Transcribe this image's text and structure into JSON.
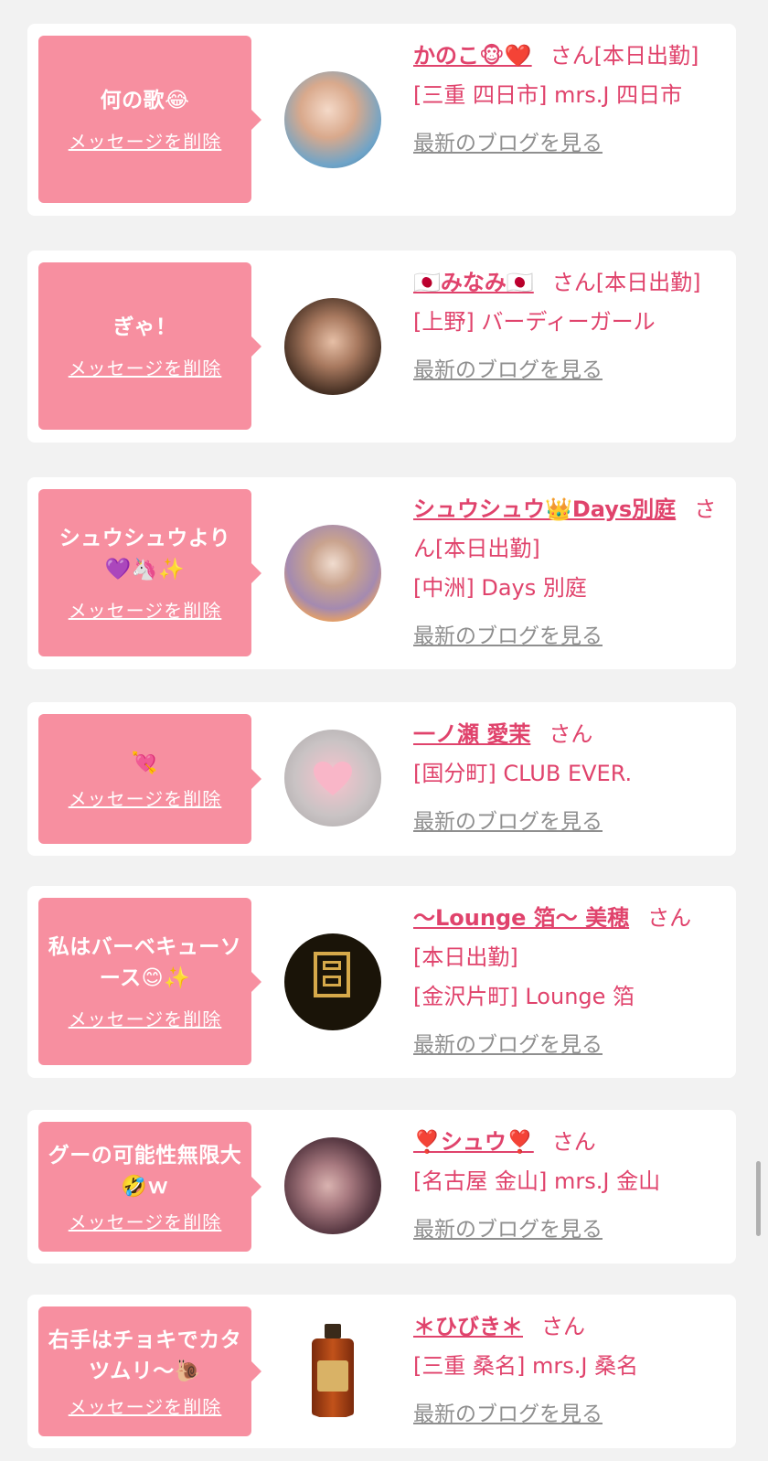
{
  "delete_label": "メッセージを削除",
  "blog_label": "最新のブログを見る",
  "san_label": "さん",
  "colors": {
    "accent": "#e0436c",
    "bubble": "#f78fa0",
    "link_gray": "#8f8f8f",
    "background": "#f2f2f2"
  },
  "items": [
    {
      "message": "何の歌😂",
      "name": "かのこ🐵❤️",
      "status": "[本日出勤]",
      "shop": "[三重 四日市] mrs.J 四日市"
    },
    {
      "message": "ぎゃ！",
      "name": "🇯🇵みなみ🇯🇵",
      "status": "[本日出勤]",
      "shop": "[上野] バーディーガール"
    },
    {
      "message": "シュウシュウより💜🦄✨",
      "name": "シュウシュウ👑Days別庭",
      "status": "[本日出勤]",
      "shop": "[中洲] Days 別庭"
    },
    {
      "message": "💘",
      "name": "一ノ瀬 愛茉",
      "status": "",
      "shop": "[国分町] CLUB EVER."
    },
    {
      "message": "私はバーベキューソース😊✨",
      "name": "〜Lounge 箔〜 美穂",
      "status": "[本日出勤]",
      "shop": "[金沢片町] Lounge 箔"
    },
    {
      "message": "グーの可能性無限大🤣ｗ",
      "name": "❣️シュウ❣️",
      "status": "",
      "shop": "[名古屋 金山] mrs.J 金山"
    },
    {
      "message": "右手はチョキでカタツムリ〜🐌",
      "name": "＊ひびき＊",
      "status": "",
      "shop": "[三重 桑名] mrs.J 桑名"
    }
  ]
}
